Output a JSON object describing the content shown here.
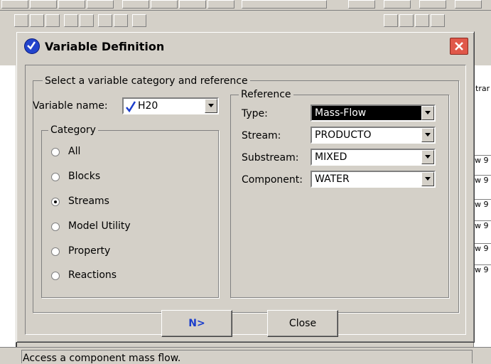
{
  "dialog": {
    "title": "Variable Definition",
    "main_group_label": "Select a variable category and reference",
    "variable_name_label": "Variable name:",
    "variable_name_value": "H20",
    "category": {
      "label": "Category",
      "options": [
        {
          "label": "All",
          "selected": false
        },
        {
          "label": "Blocks",
          "selected": false
        },
        {
          "label": "Streams",
          "selected": true
        },
        {
          "label": "Model Utility",
          "selected": false
        },
        {
          "label": "Property",
          "selected": false
        },
        {
          "label": "Reactions",
          "selected": false
        }
      ]
    },
    "reference": {
      "label": "Reference",
      "fields": [
        {
          "label": "Type:",
          "value": "Mass-Flow"
        },
        {
          "label": "Stream:",
          "value": "PRODUCTO"
        },
        {
          "label": "Substream:",
          "value": "MIXED"
        },
        {
          "label": "Component:",
          "value": "WATER"
        }
      ]
    },
    "next_button_label": "N>",
    "close_button_label": "Close"
  },
  "background": {
    "right_column_header": "trar",
    "right_column_cells": [
      "w 9",
      "w 9",
      "w 9",
      "w 9",
      "w 9",
      "w 9"
    ]
  },
  "status": {
    "text": "Access a component mass flow."
  },
  "colors": {
    "title_icon": "#2244cc",
    "close_button": "#e0584a",
    "selected_field_bg": "#000000",
    "next_button_text": "#1a3dcc",
    "check_mark": "#1a3dcc"
  }
}
